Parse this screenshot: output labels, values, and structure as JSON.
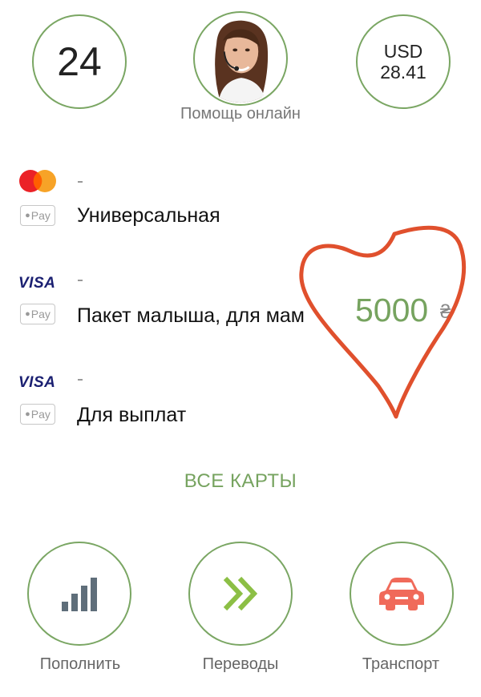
{
  "top": {
    "days": "24",
    "help_label": "Помощь онлайн",
    "rate_currency": "USD",
    "rate_value": "28.41"
  },
  "cards": [
    {
      "brand": "mastercard",
      "pay": "Pay",
      "name": "Универсальная"
    },
    {
      "brand": "VISA",
      "pay": "Pay",
      "name": "Пакет малыша, для мам",
      "amount": "5000",
      "currency": "₴"
    },
    {
      "brand": "VISA",
      "pay": "Pay",
      "name": "Для выплат"
    }
  ],
  "all_cards": "ВСЕ КАРТЫ",
  "actions": [
    {
      "label": "Пополнить",
      "icon": "signal-bars-icon"
    },
    {
      "label": "Переводы",
      "icon": "double-chevron-icon"
    },
    {
      "label": "Транспорт",
      "icon": "car-icon"
    }
  ],
  "colors": {
    "accent": "#76a35f",
    "heart": "#e0502d",
    "car": "#f06a5a",
    "bars": "#5f6e7a"
  }
}
